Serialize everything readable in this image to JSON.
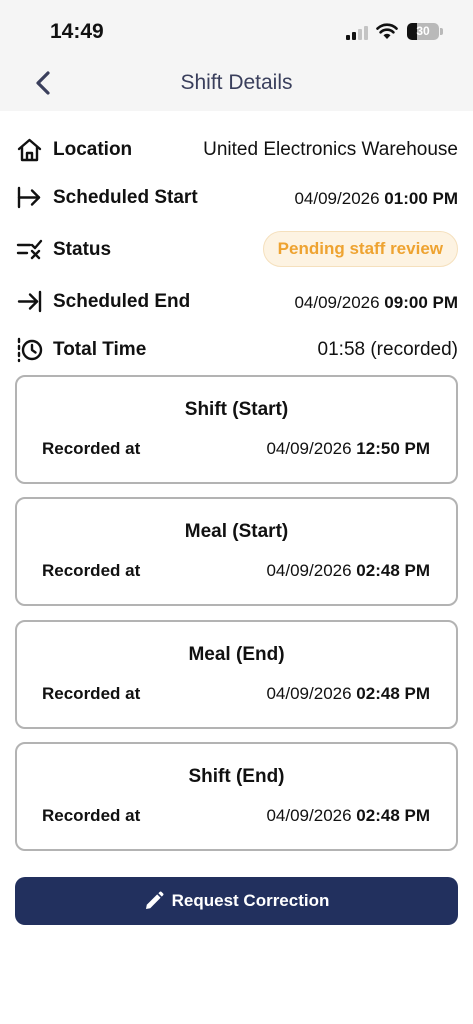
{
  "status_bar": {
    "time": "14:49",
    "battery_level": "30",
    "battery_percent": 30,
    "signal_bars": 2
  },
  "nav": {
    "title": "Shift Details",
    "back_icon": "chevron-left-icon"
  },
  "details": {
    "location": {
      "label": "Location",
      "value": "United Electronics Warehouse",
      "icon": "home-icon"
    },
    "scheduled_start": {
      "label": "Scheduled Start",
      "date": "04/09/2026",
      "time": "01:00 PM",
      "icon": "arrow-from-bar-icon"
    },
    "status": {
      "label": "Status",
      "value": "Pending staff review",
      "icon": "list-check-icon",
      "badge_bg": "#fdf3e2",
      "badge_fg": "#eea331"
    },
    "scheduled_end": {
      "label": "Scheduled End",
      "date": "04/09/2026",
      "time": "09:00 PM",
      "icon": "arrow-to-bar-icon"
    },
    "total_time": {
      "label": "Total Time",
      "value": "01:58 (recorded)",
      "icon": "clock-history-icon"
    }
  },
  "records": [
    {
      "title": "Shift (Start)",
      "label": "Recorded at",
      "date": "04/09/2026",
      "time": "12:50 PM"
    },
    {
      "title": "Meal (Start)",
      "label": "Recorded at",
      "date": "04/09/2026",
      "time": "02:48 PM"
    },
    {
      "title": "Meal (End)",
      "label": "Recorded at",
      "date": "04/09/2026",
      "time": "02:48 PM"
    },
    {
      "title": "Shift (End)",
      "label": "Recorded at",
      "date": "04/09/2026",
      "time": "02:48 PM"
    }
  ],
  "action": {
    "label": "Request Correction",
    "icon": "pencil-icon",
    "color": "#22305e"
  }
}
